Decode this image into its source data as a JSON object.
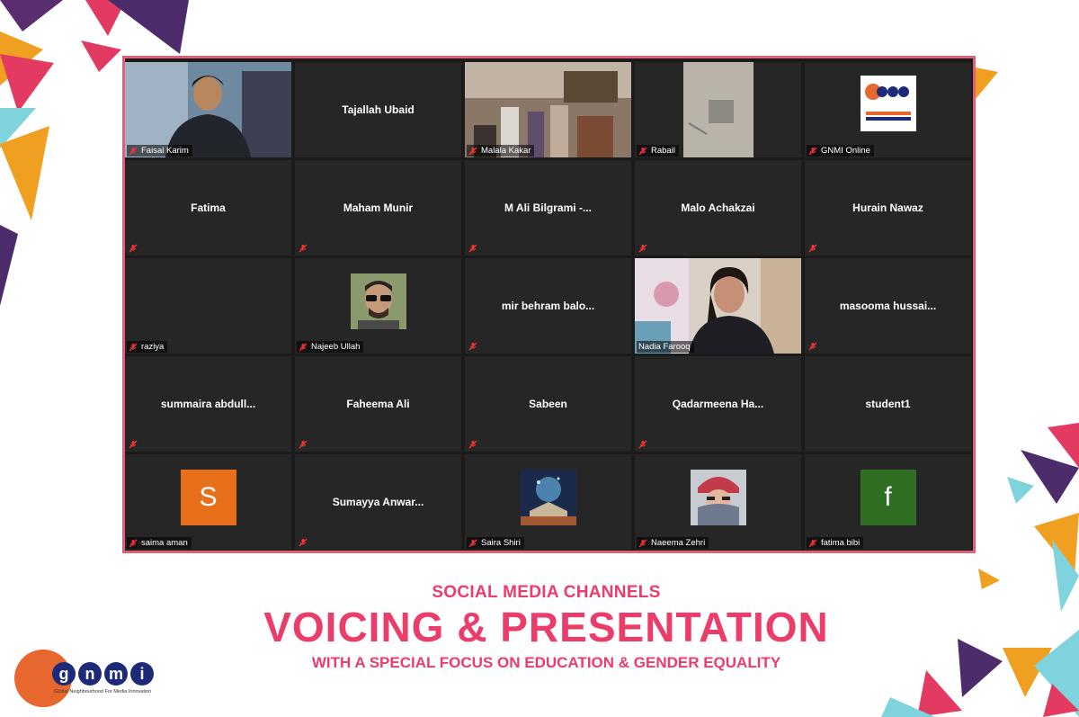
{
  "colors": {
    "accent": "#ea3d69",
    "frame": "#e0607a",
    "active_speaker": "#d7e66a",
    "tile_bg": "#262626"
  },
  "participants": [
    {
      "name": "Faisal Karim",
      "display": "video",
      "label": "Faisal Karim"
    },
    {
      "name": "Tajallah Ubaid",
      "display": "name",
      "label": ""
    },
    {
      "name": "Malala Kakar",
      "display": "video",
      "label": "Malala Kakar"
    },
    {
      "name": "Rabail",
      "display": "video",
      "label": "Rabail"
    },
    {
      "name": "GNMI Online",
      "display": "logo",
      "label": "GNMI Online"
    },
    {
      "name": "Fatima",
      "display": "name",
      "label": ""
    },
    {
      "name": "Maham Munir",
      "display": "name",
      "label": ""
    },
    {
      "name": "M Ali Bilgrami -...",
      "display": "name",
      "label": ""
    },
    {
      "name": "Malo Achakzai",
      "display": "name",
      "label": ""
    },
    {
      "name": "Hurain Nawaz",
      "display": "name",
      "label": ""
    },
    {
      "name": "raziya",
      "display": "blank",
      "label": "raziya"
    },
    {
      "name": "Najeeb Ullah",
      "display": "photo",
      "label": "Najeeb Ullah"
    },
    {
      "name": "mir behram balo...",
      "display": "name",
      "label": ""
    },
    {
      "name": "Nadia Farooq",
      "display": "video",
      "label": "Nadia Farooq",
      "active": true
    },
    {
      "name": "masooma hussai...",
      "display": "name",
      "label": ""
    },
    {
      "name": "summaira abdull...",
      "display": "name",
      "label": ""
    },
    {
      "name": "Faheema Ali",
      "display": "name",
      "label": ""
    },
    {
      "name": "Sabeen",
      "display": "name",
      "label": ""
    },
    {
      "name": "Qadarmeena Ha...",
      "display": "name",
      "label": ""
    },
    {
      "name": "student1",
      "display": "name",
      "label": ""
    },
    {
      "name": "saima aman",
      "display": "letter",
      "letter": "S",
      "letter_color": "#e8701a",
      "label": "saima aman"
    },
    {
      "name": "Sumayya Anwar...",
      "display": "name",
      "label": ""
    },
    {
      "name": "Saira Shiri",
      "display": "photo",
      "label": "Saira Shiri"
    },
    {
      "name": "Naeema Zehri",
      "display": "photo",
      "label": "Naeema Zehri"
    },
    {
      "name": "fatima bibi",
      "display": "letter",
      "letter": "f",
      "letter_color": "#2f6e23",
      "label": "fatima bibi"
    }
  ],
  "captions": {
    "line1": "SOCIAL MEDIA CHANNELS",
    "line2": "VOICING & PRESENTATION",
    "line3": "WITH A SPECIAL FOCUS ON EDUCATION & GENDER EQUALITY"
  },
  "logo": {
    "letters": [
      "g",
      "n",
      "m",
      "i"
    ],
    "tagline": "Global Neighbourhood For Media Innovation"
  },
  "icons": {
    "muted_mic": "mic-muted-icon"
  }
}
